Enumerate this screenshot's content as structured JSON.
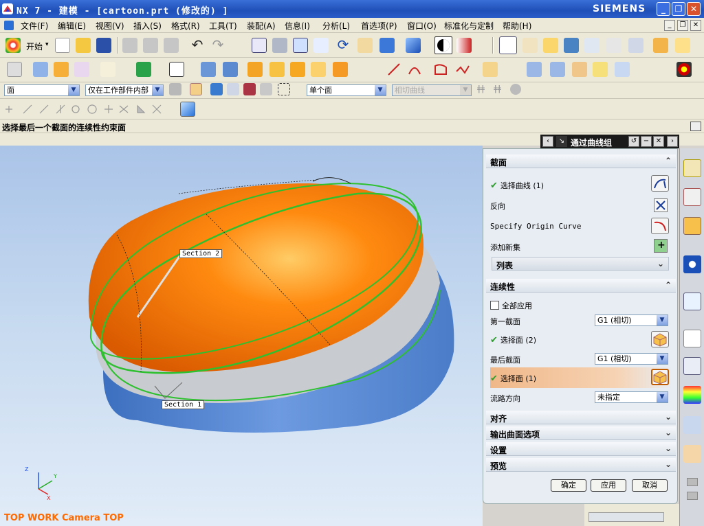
{
  "window": {
    "title": "NX 7 - 建模 - [cartoon.prt  (修改的) ]",
    "brand": "SIEMENS"
  },
  "menu": [
    "文件(F)",
    "编辑(E)",
    "视图(V)",
    "插入(S)",
    "格式(R)",
    "工具(T)",
    "装配(A)",
    "信息(I)",
    "分析(L)",
    "首选项(P)",
    "窗口(O)",
    "标准化与定制",
    "帮助(H)"
  ],
  "toolbar": {
    "start_label": "开始"
  },
  "selection": {
    "type_filter": "面",
    "scope": "仅在工作部件内部",
    "face_rule": "单个面",
    "curve_rule": "相切曲线"
  },
  "cue": "选择最后一个截面的连续性约束面",
  "viewport": {
    "label": "TOP WORK Camera TOP",
    "section1": "Section  1",
    "section2": "Section  2"
  },
  "colors": {
    "surface": "#ff7a00",
    "base": "#5b8ed8",
    "curve": "#2ec02e"
  },
  "dialog": {
    "title": "通过曲线组",
    "section_group": "截面",
    "select_curve": "选择曲线 (1)",
    "reverse": "反向",
    "origin_curve": "Specify Origin Curve",
    "add_new_set": "添加新集",
    "list": "列表",
    "continuity_group": "连续性",
    "apply_all": "全部应用",
    "first_section": "第一截面",
    "first_value": "G1 (相切)",
    "select_face_1": "选择面 (2)",
    "last_section": "最后截面",
    "last_value": "G1 (相切)",
    "select_face_2": "选择面 (1)",
    "flow_dir": "流路方向",
    "flow_value": "未指定",
    "alignment": "对齐",
    "output_options": "输出曲面选项",
    "settings": "设置",
    "preview": "预览",
    "ok": "确定",
    "apply": "应用",
    "cancel": "取消"
  }
}
